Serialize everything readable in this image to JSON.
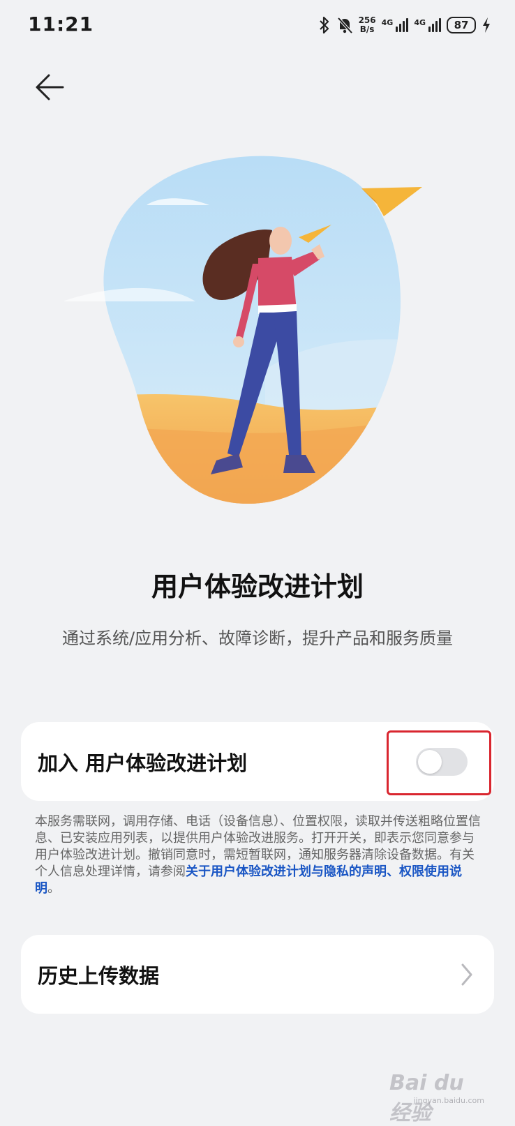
{
  "status_bar": {
    "time": "11:21",
    "net_speed_value": "256",
    "net_speed_unit": "B/s",
    "signal1_label": "4G",
    "signal2_label": "4G",
    "battery": "87",
    "icons": [
      "bluetooth-icon",
      "bell-off-icon",
      "signal-icon",
      "battery-icon",
      "charging-icon"
    ]
  },
  "header": {
    "back_icon": "arrow-left-icon"
  },
  "hero": {
    "title": "用户体验改进计划",
    "subtitle": "通过系统/应用分析、故障诊断，提升产品和服务质量"
  },
  "join_card": {
    "label": "加入 用户体验改进计划",
    "toggle_state": "off"
  },
  "notice": {
    "text": "本服务需联网，调用存储、电话（设备信息）、位置权限，读取并传送粗略位置信息、已安装应用列表，以提供用户体验改进服务。打开开关，即表示您同意参与用户体验改进计划。撤销同意时，需短暂联网，通知服务器清除设备数据。有关个人信息处理详情，请参阅",
    "link1": "关于用户体验改进计划与隐私的声明",
    "separator": "、",
    "link2": "权限使用说明",
    "end": "。"
  },
  "history_card": {
    "label": "历史上传数据",
    "icon": "chevron-right-icon"
  },
  "watermark": {
    "text": "Bai du 经验",
    "sub": "jingyan.baidu.com"
  },
  "colors": {
    "background": "#f1f2f4",
    "card": "#ffffff",
    "link": "#1a56c4",
    "highlight": "#d9262f",
    "toggle_off": "#e1e2e5"
  }
}
